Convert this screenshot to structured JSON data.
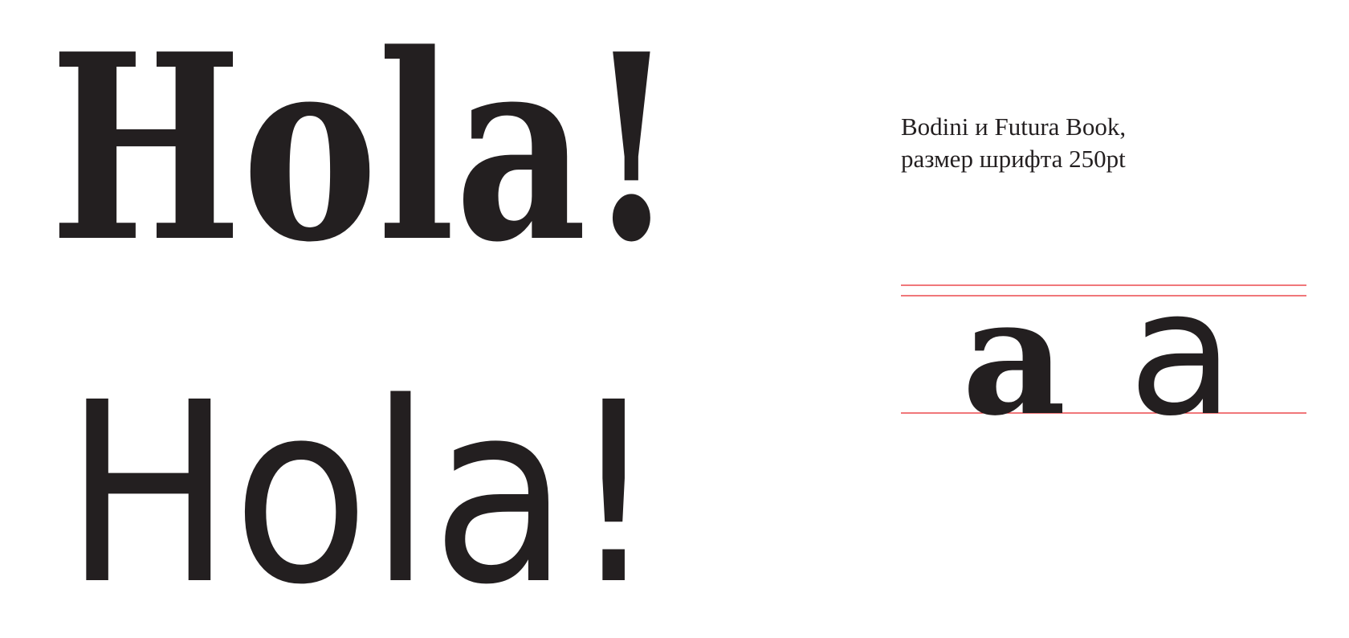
{
  "specimen": {
    "serif_sample": "Hola!",
    "sans_sample": "Hola!",
    "compare_serif_glyph": "a",
    "compare_sans_glyph": "a"
  },
  "caption": {
    "line1": "Bodini и Futura Book,",
    "line2": "размер шрифта 250pt"
  },
  "colors": {
    "text": "#231f20",
    "guides": "#e8262a",
    "background": "#ffffff"
  }
}
